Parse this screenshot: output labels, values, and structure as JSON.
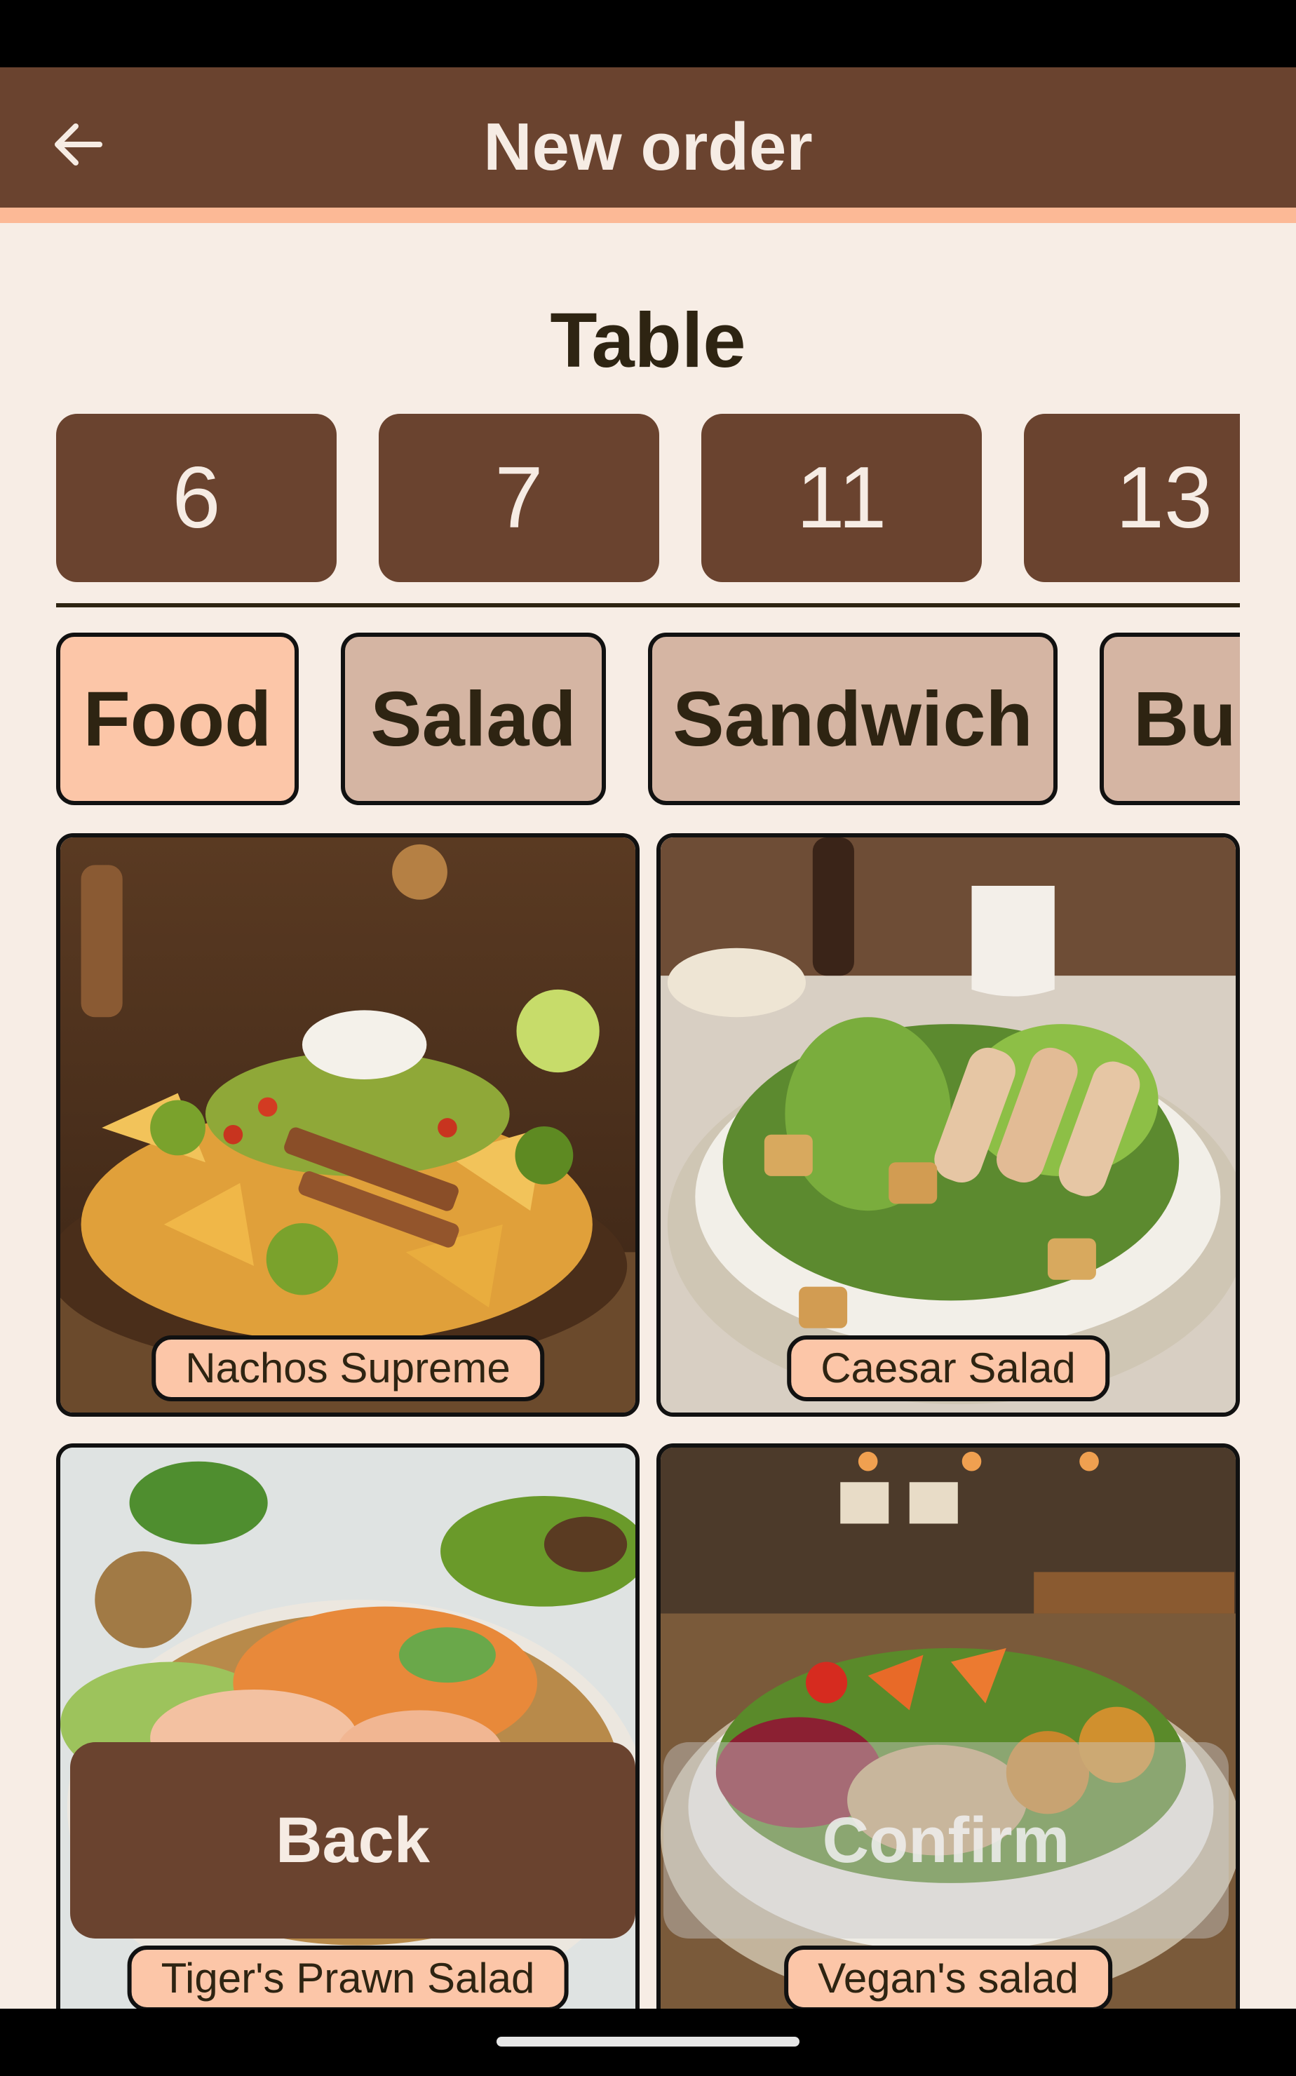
{
  "app_bar": {
    "title": "New order",
    "back_icon": "arrow-left-icon"
  },
  "table_section": {
    "title": "Table",
    "tables": [
      "6",
      "7",
      "11",
      "13"
    ]
  },
  "categories": [
    {
      "label": "Food",
      "selected": true
    },
    {
      "label": "Salad",
      "selected": false
    },
    {
      "label": "Sandwich",
      "selected": false
    },
    {
      "label": "Burger",
      "selected": false
    }
  ],
  "menu_items": [
    {
      "name": "Nachos Supreme"
    },
    {
      "name": "Caesar Salad"
    },
    {
      "name": "Tiger's Prawn Salad"
    },
    {
      "name": "Vegan's salad"
    }
  ],
  "actions": {
    "back_label": "Back",
    "confirm_label": "Confirm"
  },
  "colors": {
    "primary_brown": "#6a432f",
    "accent_peach": "#fcb996",
    "background": "#f7ede5",
    "chip_selected": "#fcc6a8",
    "chip_unselected": "#d5b5a3"
  }
}
